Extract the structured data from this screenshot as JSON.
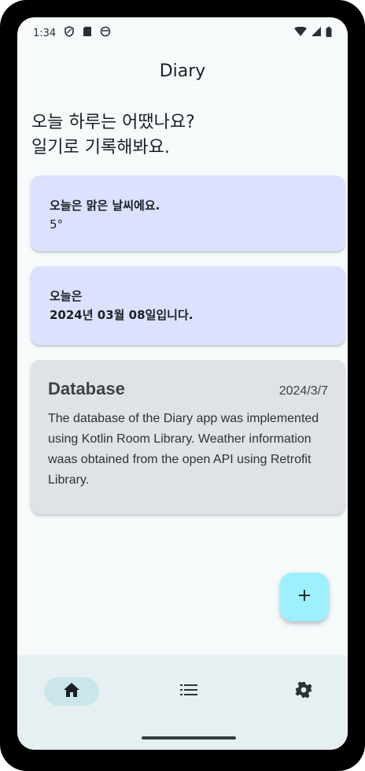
{
  "status_bar": {
    "time": "1:34",
    "left_icons": [
      "shield-icon",
      "sd-card-icon",
      "sync-icon"
    ],
    "right_icons": [
      "wifi-icon",
      "signal-icon",
      "battery-icon"
    ]
  },
  "app": {
    "title": "Diary"
  },
  "headline": {
    "line1": "오늘 하루는 어땠나요?",
    "line2": "일기로 기록해봐요."
  },
  "weather_card": {
    "line1": "오늘은 맑은 날씨에요.",
    "temperature": "5°"
  },
  "date_card": {
    "line1": "오늘은",
    "line2": "2024년 03월 08일입니다."
  },
  "note_card": {
    "title": "Database",
    "date": "2024/3/7",
    "body": "The database of the Diary app was implemented using Kotlin Room Library. Weather information waas obtained from the open API using Retrofit Library."
  },
  "fab": {
    "label": "+"
  },
  "bottom_nav": {
    "items": [
      {
        "icon": "home-icon",
        "selected": true
      },
      {
        "icon": "list-icon",
        "selected": false
      },
      {
        "icon": "settings-icon",
        "selected": false
      }
    ]
  },
  "colors": {
    "background": "#f5fafb",
    "card_primary": "#dbe1ff",
    "card_note": "#dde3e6",
    "fab": "#9cf0ff",
    "nav_bar": "#e6f0f2",
    "nav_selected": "#cbe6eb"
  }
}
